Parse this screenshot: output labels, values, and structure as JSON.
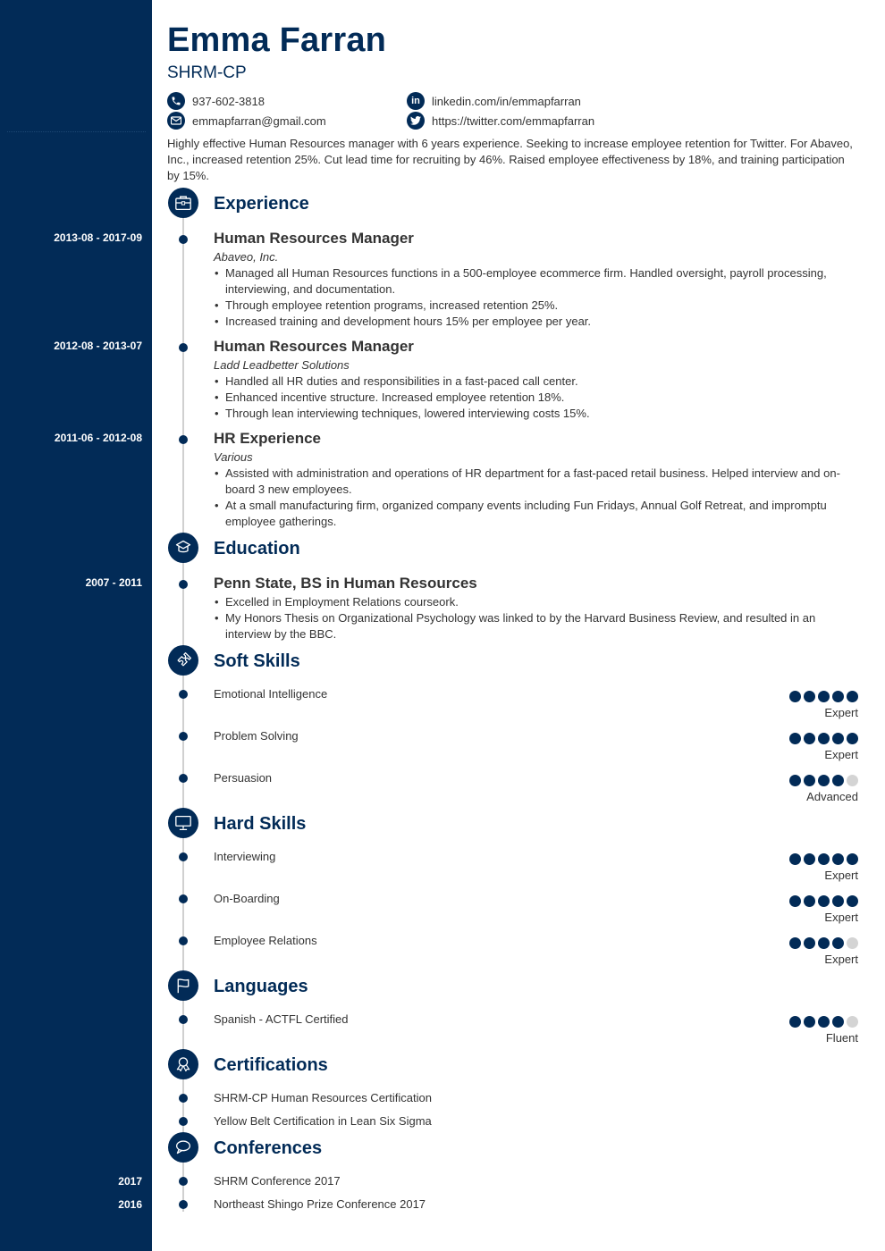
{
  "header": {
    "name": "Emma Farran",
    "title": "SHRM-CP",
    "contacts": [
      {
        "icon": "phone-icon",
        "text": "937-602-3818"
      },
      {
        "icon": "email-icon",
        "text": "emmapfarran@gmail.com"
      },
      {
        "icon": "linkedin-icon",
        "text": "linkedin.com/in/emmapfarran"
      },
      {
        "icon": "twitter-icon",
        "text": "https://twitter.com/emmapfarran"
      }
    ],
    "summary": "Highly effective Human Resources manager with 6 years experience. Seeking to increase employee retention for Twitter. For Abaveo, Inc., increased retention 25%. Cut lead time for recruiting by 46%. Raised employee effectiveness by 18%, and training participation by 15%."
  },
  "colors": {
    "primary": "#022b57",
    "timeline": "#d0d0d0",
    "rating_off": "#d4d4d4"
  },
  "experience": {
    "heading": "Experience",
    "icon": "briefcase-icon",
    "jobs": [
      {
        "dates": "2013-08 - 2017-09",
        "title": "Human Resources Manager",
        "company": "Abaveo, Inc.",
        "bullets": [
          "Managed all Human Resources functions in a 500-employee ecommerce firm. Handled oversight, payroll processing, interviewing, and documentation.",
          "Through employee retention programs, increased retention 25%.",
          "Increased training and development hours 15% per employee per year."
        ]
      },
      {
        "dates": "2012-08 - 2013-07",
        "title": "Human Resources Manager",
        "company": "Ladd Leadbetter Solutions",
        "bullets": [
          "Handled all HR duties and responsibilities in a fast-paced call center.",
          "Enhanced incentive structure. Increased employee retention 18%.",
          "Through lean interviewing techniques, lowered interviewing costs 15%."
        ]
      },
      {
        "dates": "2011-06 - 2012-08",
        "title": "HR Experience",
        "company": "Various",
        "bullets": [
          "Assisted with administration and operations of HR department for a fast-paced retail business. Helped interview and on-board 3 new employees.",
          "At a small manufacturing firm, organized company events including Fun Fridays, Annual Golf Retreat, and impromptu employee gatherings."
        ]
      }
    ]
  },
  "education": {
    "heading": "Education",
    "icon": "graduation-cap-icon",
    "items": [
      {
        "dates": "2007 - 2011",
        "title": "Penn State, BS in Human Resources",
        "bullets": [
          "Excelled in Employment Relations courseork.",
          "My Honors Thesis on Organizational Psychology was linked to by the Harvard Business Review, and resulted in an interview by the BBC."
        ]
      }
    ]
  },
  "soft_skills": {
    "heading": "Soft Skills",
    "icon": "puzzle-icon",
    "items": [
      {
        "name": "Emotional Intelligence",
        "rating": 5,
        "max": 5,
        "level": "Expert"
      },
      {
        "name": "Problem Solving",
        "rating": 5,
        "max": 5,
        "level": "Expert"
      },
      {
        "name": "Persuasion",
        "rating": 4,
        "max": 5,
        "level": "Advanced"
      }
    ]
  },
  "hard_skills": {
    "heading": "Hard Skills",
    "icon": "monitor-icon",
    "items": [
      {
        "name": "Interviewing",
        "rating": 5,
        "max": 5,
        "level": "Expert"
      },
      {
        "name": "On-Boarding",
        "rating": 5,
        "max": 5,
        "level": "Expert"
      },
      {
        "name": "Employee Relations",
        "rating": 4,
        "max": 5,
        "level": "Expert"
      }
    ]
  },
  "languages": {
    "heading": "Languages",
    "icon": "flag-icon",
    "items": [
      {
        "name": "Spanish - ACTFL Certified",
        "rating": 4,
        "max": 5,
        "level": "Fluent"
      }
    ]
  },
  "certifications": {
    "heading": "Certifications",
    "icon": "award-ribbon-icon",
    "items": [
      "SHRM-CP Human Resources Certification",
      "Yellow Belt Certification in Lean Six Sigma"
    ]
  },
  "conferences": {
    "heading": "Conferences",
    "icon": "speech-bubble-icon",
    "items": [
      {
        "year": "2017",
        "name": "SHRM Conference 2017"
      },
      {
        "year": "2016",
        "name": "Northeast Shingo Prize Conference 2017"
      }
    ]
  }
}
